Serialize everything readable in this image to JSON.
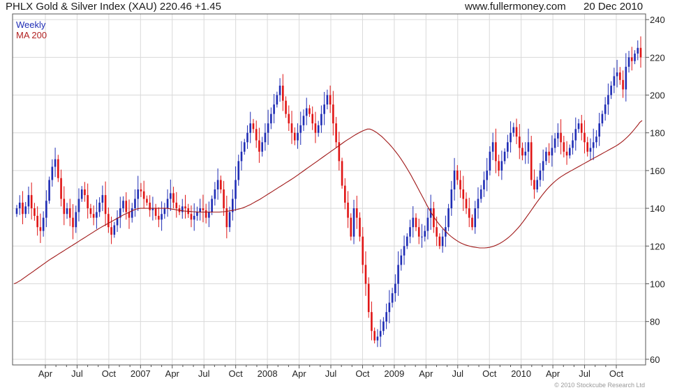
{
  "header": {
    "title": "PHLX Gold & Silver Index (XAU) 220.46 +1.45",
    "site": "www.fullermoney.com",
    "date": "20 Dec 2010"
  },
  "legend": {
    "weekly": "Weekly",
    "ma": "MA 200"
  },
  "copyright": "© 2010 Stockcube Research Ltd",
  "colors": {
    "up": "#1f2db5",
    "down": "#e01515",
    "ma": "#a01818",
    "grid": "#d9d9d9",
    "frame": "#555555"
  },
  "chart_data": {
    "type": "candlestick",
    "ylim": [
      57,
      243
    ],
    "y_ticks": [
      60,
      80,
      100,
      120,
      140,
      160,
      180,
      200,
      220,
      240
    ],
    "x_ticks": [
      "Apr",
      "Jul",
      "Oct",
      "2007",
      "Apr",
      "Jul",
      "Oct",
      "2008",
      "Apr",
      "Jul",
      "Oct",
      "2009",
      "Apr",
      "Jul",
      "Oct",
      "2010",
      "Apr",
      "Jul",
      "Oct"
    ],
    "grid": true,
    "series": [
      {
        "name": "Weekly",
        "close": [
          140,
          143,
          137,
          141,
          147,
          140,
          136,
          130,
          128,
          135,
          144,
          155,
          162,
          166,
          156,
          145,
          137,
          140,
          135,
          130,
          138,
          145,
          150,
          147,
          140,
          137,
          135,
          138,
          143,
          147,
          137,
          130,
          126,
          131,
          135,
          140,
          144,
          138,
          135,
          140,
          145,
          150,
          149,
          145,
          143,
          139,
          140,
          136,
          134,
          137,
          140,
          145,
          148,
          143,
          140,
          138,
          141,
          140,
          137,
          134,
          136,
          138,
          140,
          139,
          135,
          138,
          145,
          150,
          155,
          150,
          140,
          130,
          138,
          145,
          155,
          165,
          170,
          175,
          180,
          185,
          182,
          176,
          170,
          175,
          180,
          185,
          190,
          195,
          200,
          205,
          197,
          190,
          185,
          180,
          176,
          180,
          184,
          189,
          193,
          190,
          185,
          180,
          184,
          190,
          195,
          200,
          195,
          185,
          175,
          165,
          152,
          143,
          135,
          125,
          140,
          135,
          125,
          110,
          100,
          85,
          75,
          70,
          72,
          75,
          80,
          85,
          90,
          95,
          100,
          110,
          115,
          120,
          125,
          130,
          135,
          130,
          125,
          125,
          128,
          135,
          140,
          130,
          125,
          120,
          125,
          130,
          140,
          150,
          160,
          155,
          150,
          145,
          140,
          135,
          130,
          140,
          145,
          150,
          155,
          160,
          170,
          175,
          165,
          160,
          165,
          170,
          175,
          180,
          183,
          178,
          172,
          168,
          170,
          175,
          155,
          150,
          155,
          160,
          165,
          170,
          168,
          172,
          177,
          180,
          175,
          170,
          168,
          172,
          176,
          182,
          185,
          180,
          175,
          170,
          172,
          175,
          178,
          185,
          190,
          195,
          200,
          205,
          210,
          212,
          208,
          203,
          215,
          220,
          218,
          222,
          225,
          220
        ],
        "rel_volatility": 0.6
      },
      {
        "name": "MA 200",
        "values": [
          100,
          100.5,
          101.2,
          102,
          102.9,
          103.8,
          104.7,
          105.6,
          106.5,
          107.4,
          108.3,
          109.2,
          110.1,
          111,
          111.9,
          112.8,
          113.6,
          114.4,
          115.2,
          116,
          116.8,
          117.6,
          118.4,
          119.2,
          120,
          120.8,
          121.6,
          122.4,
          123.2,
          124,
          124.8,
          125.6,
          126.4,
          127.2,
          128,
          128.8,
          129.6,
          130.3,
          131,
          131.7,
          132.4,
          133.1,
          133.8,
          134.5,
          135.2,
          135.9,
          136.6,
          137.2,
          137.8,
          138.4,
          139,
          139.5,
          139.8,
          140,
          140,
          140,
          140,
          140,
          140,
          140,
          140,
          140,
          140,
          140,
          140,
          139.8,
          139.6,
          139.4,
          139.2,
          139,
          138.8,
          138.6,
          138.5,
          138.4,
          138.3,
          138.2,
          138.1,
          138,
          138,
          138,
          138,
          138,
          138,
          138,
          138,
          138,
          138,
          138.1,
          138.2,
          138.4,
          138.6,
          138.8,
          139,
          139.3,
          139.6,
          139.9,
          140.3,
          140.8,
          141.4,
          142,
          142.7,
          143.4,
          144.1,
          144.8,
          145.6,
          146.4,
          147.2,
          148,
          148.8,
          149.6,
          150.4,
          151.2,
          152,
          152.8,
          153.6,
          154.4,
          155.2,
          156,
          156.9,
          157.8,
          158.7,
          159.6,
          160.5,
          161.4,
          162.3,
          163.2,
          164.1,
          165,
          165.9,
          166.8,
          167.7,
          168.6,
          169.5,
          170.4,
          171.3,
          172.2,
          173.1,
          174,
          174.9,
          175.8,
          176.6,
          177.4,
          178.2,
          179,
          179.7,
          180.4,
          181,
          181.5,
          182,
          182,
          181.5,
          180.8,
          180,
          179,
          178,
          176.8,
          175.5,
          174.2,
          172.8,
          171.3,
          169.7,
          168,
          166.2,
          164.3,
          162.3,
          160.2,
          158,
          155.7,
          153.4,
          151,
          148.6,
          146.2,
          143.8,
          141.4,
          139.2,
          137,
          135,
          133.2,
          131.6,
          130.1,
          128.7,
          127.4,
          126.2,
          125.1,
          124.1,
          123.2,
          122.4,
          121.7,
          121.1,
          120.6,
          120.2,
          119.9,
          119.6,
          119.4,
          119.2,
          119,
          119,
          119,
          119.1,
          119.3,
          119.6,
          120,
          120.5,
          121.1,
          121.8,
          122.6,
          123.5,
          124.5,
          125.6,
          126.8,
          128.1,
          129.5,
          131,
          132.6,
          134.3,
          136.1,
          137.9,
          139.7,
          141.5,
          143.3,
          145,
          146.7,
          148.3,
          149.8,
          151.2,
          152.5,
          153.7,
          154.8,
          155.8,
          156.7,
          157.5,
          158.3,
          159,
          159.7,
          160.4,
          161.1,
          161.8,
          162.5,
          163.2,
          163.9,
          164.6,
          165.3,
          166,
          166.7,
          167.4,
          168.1,
          168.8,
          169.5,
          170.2,
          170.9,
          171.6,
          172.3,
          173,
          173.8,
          174.7,
          175.7,
          176.8,
          178,
          179.3,
          180.7,
          182.2,
          183.8,
          185.5,
          186.5
        ]
      }
    ]
  }
}
